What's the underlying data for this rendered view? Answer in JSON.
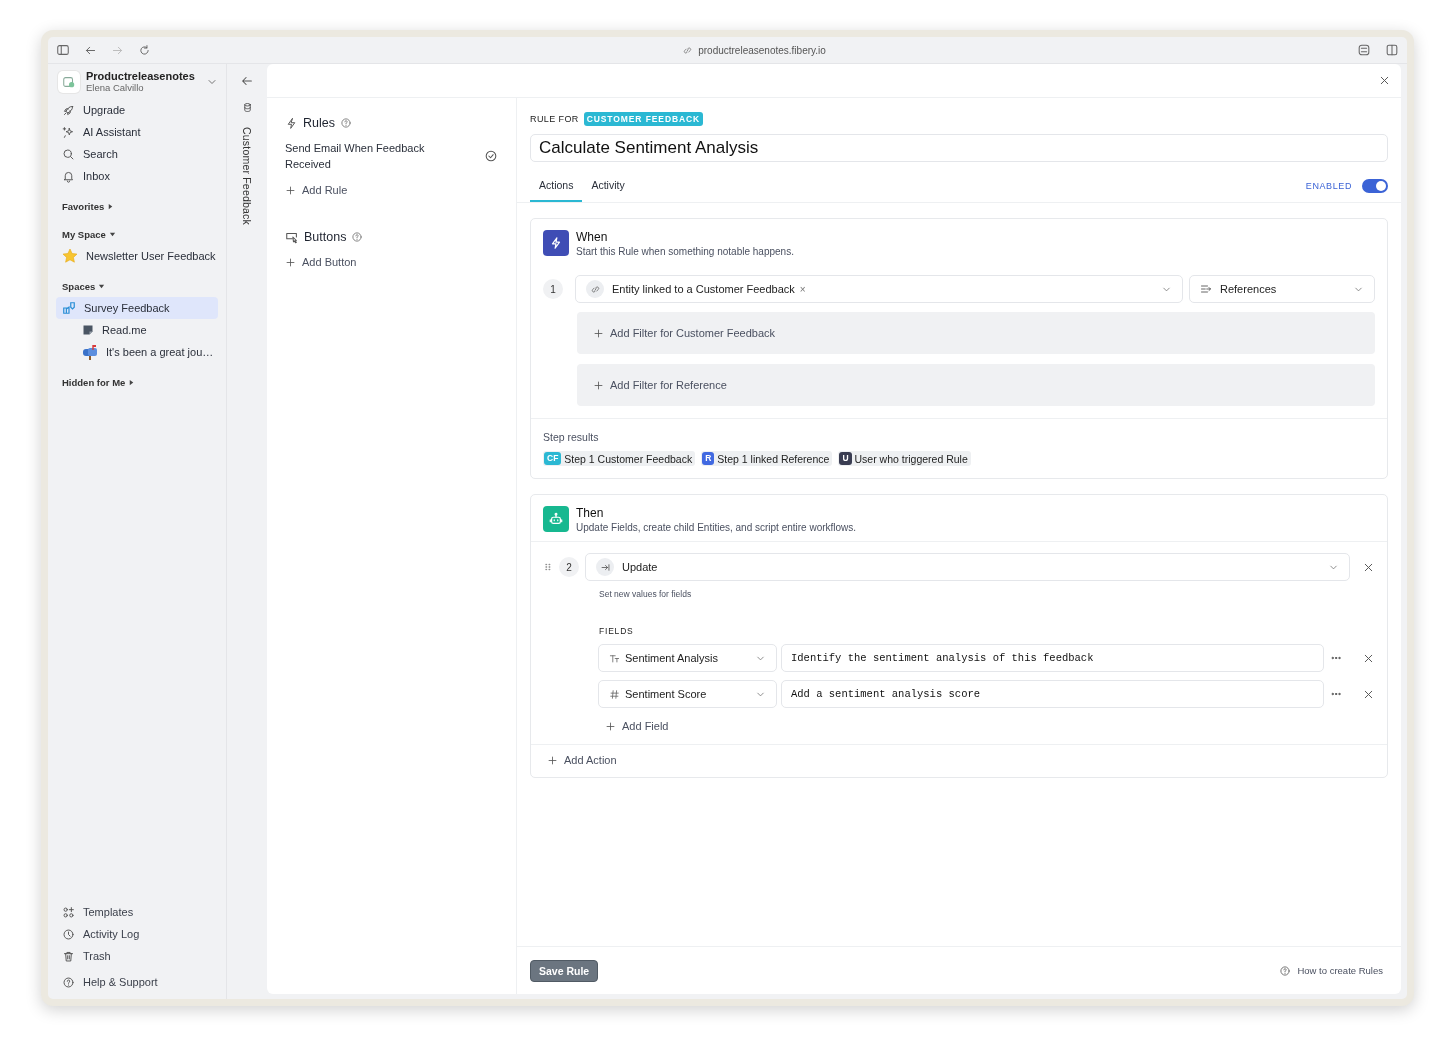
{
  "browser": {
    "url": "productreleasenotes.fibery.io"
  },
  "workspace": {
    "name": "Productreleasenotes",
    "user": "Elena Calvillo"
  },
  "sidebar": {
    "nav": [
      {
        "label": "Upgrade"
      },
      {
        "label": "AI Assistant"
      },
      {
        "label": "Search"
      },
      {
        "label": "Inbox"
      }
    ],
    "sections": [
      {
        "label": "Favorites",
        "expanded": false
      },
      {
        "label": "My Space",
        "expanded": true,
        "items": [
          {
            "label": "Newsletter User Feedback",
            "selected": false
          }
        ]
      },
      {
        "label": "Spaces",
        "expanded": true,
        "items": [
          {
            "label": "Survey Feedback",
            "selected": true,
            "children": [
              {
                "label": "Read.me",
                "selected": false
              },
              {
                "label": "It's been a great jou…",
                "selected": false
              }
            ]
          }
        ]
      },
      {
        "label": "Hidden for Me",
        "expanded": false
      }
    ],
    "footer": [
      {
        "label": "Templates"
      },
      {
        "label": "Activity Log"
      },
      {
        "label": "Trash"
      },
      {
        "label": "Help & Support"
      }
    ]
  },
  "entity_tab": "Customer Feedback",
  "rules_panel": {
    "rules_title": "Rules",
    "rules": [
      {
        "label": "Send Email When Feedback Received"
      }
    ],
    "add_rule": "Add Rule",
    "buttons_title": "Buttons",
    "add_button": "Add Button"
  },
  "rule": {
    "label": "RULE FOR",
    "database": "CUSTOMER FEEDBACK",
    "name": "Calculate Sentiment Analysis",
    "tabs": [
      {
        "label": "Actions",
        "selected": true
      },
      {
        "label": "Activity",
        "selected": false
      }
    ],
    "enabled_label": "ENABLED",
    "enabled": true,
    "when": {
      "title": "When",
      "subtitle": "Start this Rule when something notable happens.",
      "step": "1",
      "trigger": "Entity linked to a Customer Feedback",
      "trigger_remove": "×",
      "relation": "References",
      "filters": [
        "Add Filter for Customer Feedback",
        "Add Filter for Reference"
      ],
      "results_title": "Step results",
      "results": [
        {
          "badge": "CF",
          "label": "Step 1 Customer Feedback",
          "color": "#2bb8d3"
        },
        {
          "badge": "R",
          "label": "Step 1 linked Reference",
          "color": "#4169e1"
        },
        {
          "badge": "U",
          "label": "User who triggered Rule",
          "color": "#3a3d52"
        }
      ]
    },
    "then": {
      "title": "Then",
      "subtitle": "Update Fields, create child Entities, and script entire workflows.",
      "step": "2",
      "action": "Update",
      "action_hint": "Set new values for fields",
      "fields_label": "FIELDS",
      "fields": [
        {
          "name": "Sentiment Analysis",
          "kind": "text",
          "value": "Identify the sentiment analysis of this feedback"
        },
        {
          "name": "Sentiment Score",
          "kind": "number",
          "value": "Add a sentiment analysis score"
        }
      ],
      "add_field": "Add Field",
      "add_action": "Add Action"
    }
  },
  "footer": {
    "save": "Save Rule",
    "help": "How to create Rules"
  }
}
